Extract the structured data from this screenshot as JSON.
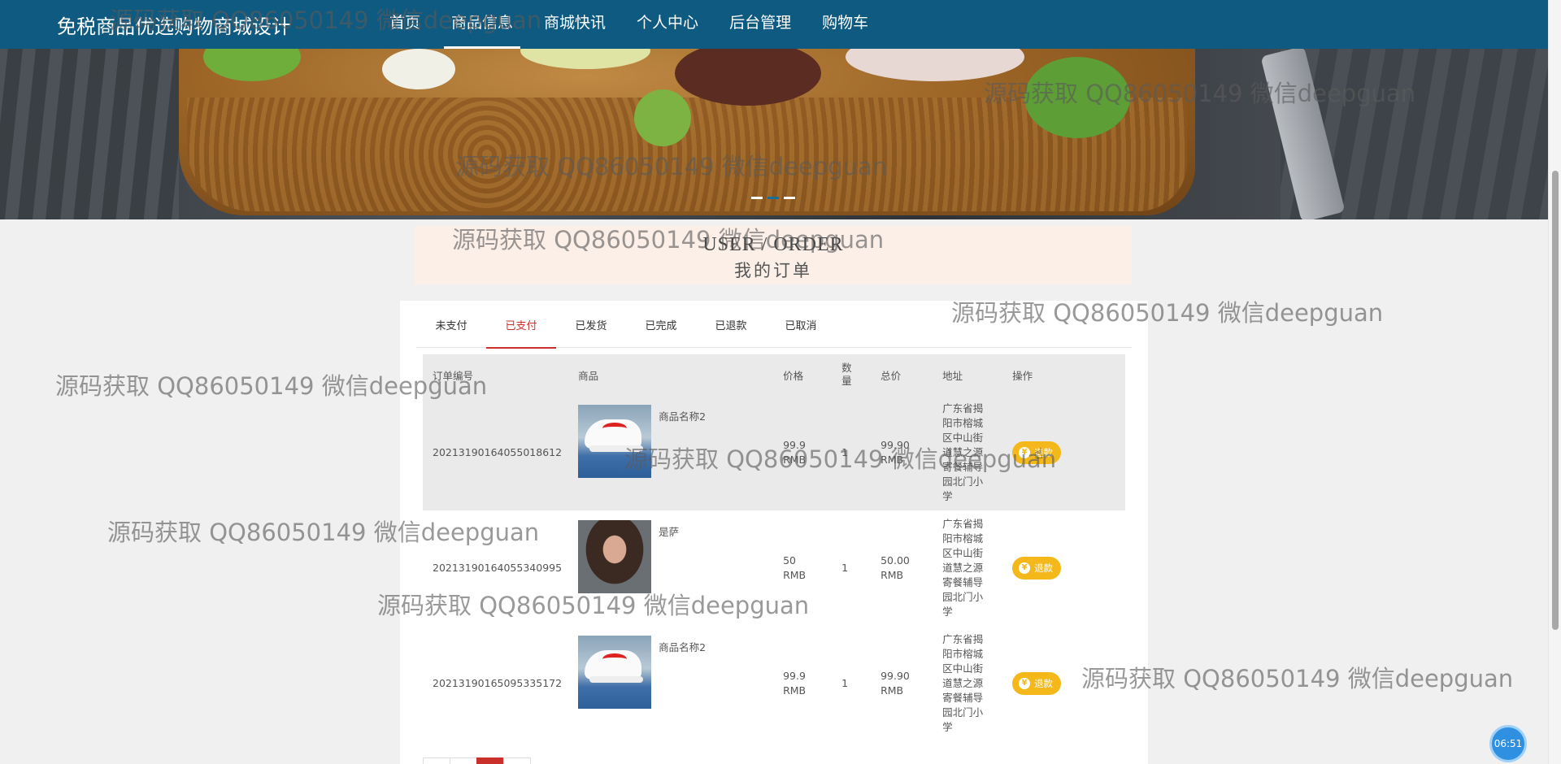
{
  "nav": {
    "brand": "免税商品优选购物商城设计",
    "items": [
      {
        "label": "首页"
      },
      {
        "label": "商品信息",
        "active": true
      },
      {
        "label": "商城快讯"
      },
      {
        "label": "个人中心"
      },
      {
        "label": "后台管理"
      },
      {
        "label": "购物车"
      }
    ]
  },
  "banner": {
    "slides": 3,
    "active_slide": 2
  },
  "title": {
    "en": "USER / ORDER",
    "cn": "我的订单"
  },
  "tabs": [
    "未支付",
    "已支付",
    "已发货",
    "已完成",
    "已退款",
    "已取消"
  ],
  "active_tab": "已支付",
  "table": {
    "headers": [
      "订单编号",
      "商品",
      "价格",
      "数量",
      "总价",
      "地址",
      "操作"
    ],
    "rows": [
      {
        "order_no": "20213190164055018612",
        "goods_name": "商品名称2",
        "thumb": "shoe-image",
        "price": "99.9 RMB",
        "qty": "1",
        "total": "99.90 RMB",
        "address": "广东省揭阳市榕城区中山街道慧之源寄餐辅导园北门小学",
        "action": "退款"
      },
      {
        "order_no": "20213190164055340995",
        "goods_name": "是萨",
        "thumb": "portrait-image",
        "price": "50 RMB",
        "qty": "1",
        "total": "50.00 RMB",
        "address": "广东省揭阳市榕城区中山街道慧之源寄餐辅导园北门小学",
        "action": "退款"
      },
      {
        "order_no": "20213190165095335172",
        "goods_name": "商品名称2",
        "thumb": "shoe-image",
        "price": "99.9 RMB",
        "qty": "1",
        "total": "99.90 RMB",
        "address": "广东省揭阳市榕城区中山街道慧之源寄餐辅导园北门小学",
        "action": "退款"
      }
    ]
  },
  "watermark": "源码获取 QQ86050149 微信deepguan",
  "clock": "06:51",
  "colors": {
    "nav": "#0e5a80",
    "accent": "#c9302c",
    "refund": "#f5b81b"
  }
}
